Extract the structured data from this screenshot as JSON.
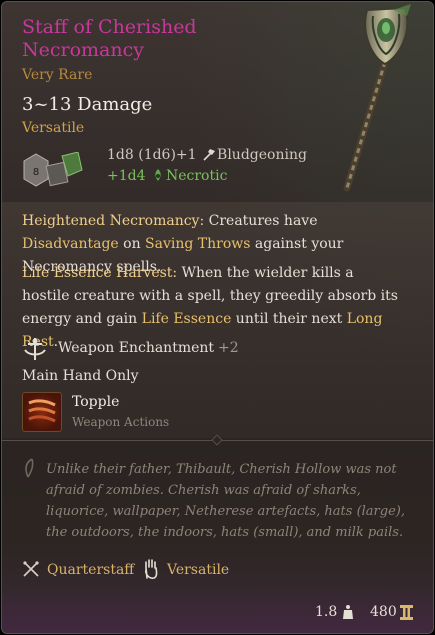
{
  "item": {
    "name": "Staff of Cherished Necromancy",
    "rarity": "Very Rare",
    "damage_range": "3~13 Damage",
    "property": "Versatile"
  },
  "damage": {
    "main": "1d8 (1d6)+1",
    "main_type": "Bludgeoning",
    "extra": "+1d4",
    "extra_type": "Necrotic"
  },
  "passives": [
    {
      "name": "Heightened Necromancy:",
      "text_1": " Creatures have ",
      "kw_1": "Disadvantage",
      "text_2": " on ",
      "kw_2": "Saving Throws",
      "text_3": " against your Necromancy spells."
    },
    {
      "name": "Life Essence Harvest:",
      "text_1": " When the wielder kills a hostile creature with a spell, they greedily absorb its energy and gain ",
      "kw_1": "Life Essence",
      "text_2": " until their next ",
      "kw_2": "Long Rest",
      "text_3": "."
    }
  ],
  "enchantment": {
    "label": "Weapon Enchantment",
    "bonus": "+2"
  },
  "restriction": "Main Hand Only",
  "action": {
    "name": "Topple",
    "category": "Weapon Actions"
  },
  "lore": "Unlike their father, Thibault, Cherish Hollow was not afraid of zombies. Cherish was afraid of sharks, liquorice, wallpaper, Netherese artefacts, hats (large), the outdoors, the indoors, hats (small), and milk pails.",
  "tags": [
    "Quarterstaff",
    "Versatile"
  ],
  "footer": {
    "weight": "1.8",
    "value": "480"
  },
  "icons": {
    "dice": "dice-icon",
    "bludgeoning": "bludgeoning-icon",
    "necrotic": "necrotic-icon",
    "enchantment": "weapon-enchantment-icon",
    "topple": "topple-icon",
    "lore": "lore-quill-icon",
    "quarterstaff": "crossed-staves-icon",
    "versatile": "hand-icon",
    "weight": "weight-icon",
    "gold": "gold-icon"
  },
  "colors": {
    "title": "#c8379a",
    "rarity": "#b5893f",
    "keyword": "#e8c06c",
    "necrotic": "#7ac25a",
    "lore": "#8d8479"
  }
}
